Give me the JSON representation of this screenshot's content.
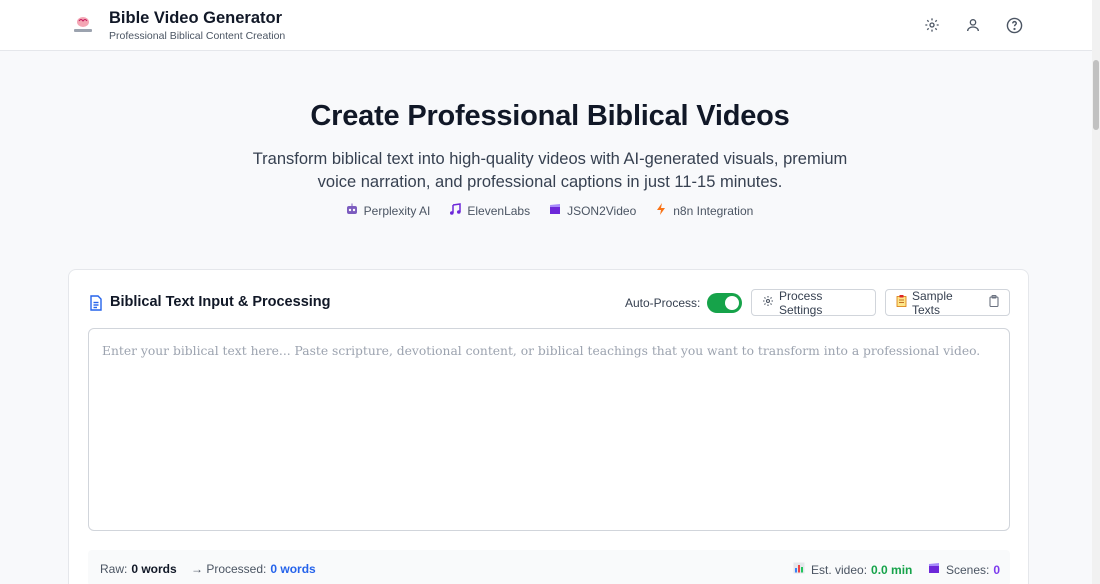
{
  "header": {
    "title": "Bible Video Generator",
    "subtitle": "Professional Biblical Content Creation",
    "icons": [
      "gear-icon",
      "user-icon",
      "help-icon"
    ]
  },
  "hero": {
    "title": "Create Professional Biblical Videos",
    "description": "Transform biblical text into high-quality videos with AI-generated visuals, premium voice narration, and professional captions in just 11-15 minutes.",
    "integrations": [
      {
        "icon": "robot-icon",
        "label": "Perplexity AI"
      },
      {
        "icon": "music-icon",
        "label": "ElevenLabs"
      },
      {
        "icon": "clapper-icon",
        "label": "JSON2Video"
      },
      {
        "icon": "lightning-icon",
        "label": "n8n Integration"
      }
    ]
  },
  "input_card": {
    "title": "Biblical Text Input & Processing",
    "auto_process_label": "Auto-Process:",
    "auto_process_on": true,
    "process_settings_label": "Process Settings",
    "sample_texts_label": "Sample Texts",
    "placeholder": "Enter your biblical text here... Paste scripture, devotional content, or biblical teachings that you want to transform into a professional video.",
    "value": ""
  },
  "stats": {
    "raw_label": "Raw:",
    "raw_value": "0 words",
    "processed_label": "→ Processed:",
    "processed_value": "0 words",
    "est_label": "Est. video:",
    "est_value": "0.0 min",
    "scenes_label": "Scenes:",
    "scenes_value": "0"
  },
  "colors": {
    "accent_green": "#16a34a",
    "accent_blue": "#2563eb",
    "accent_purple": "#7c3aed"
  }
}
